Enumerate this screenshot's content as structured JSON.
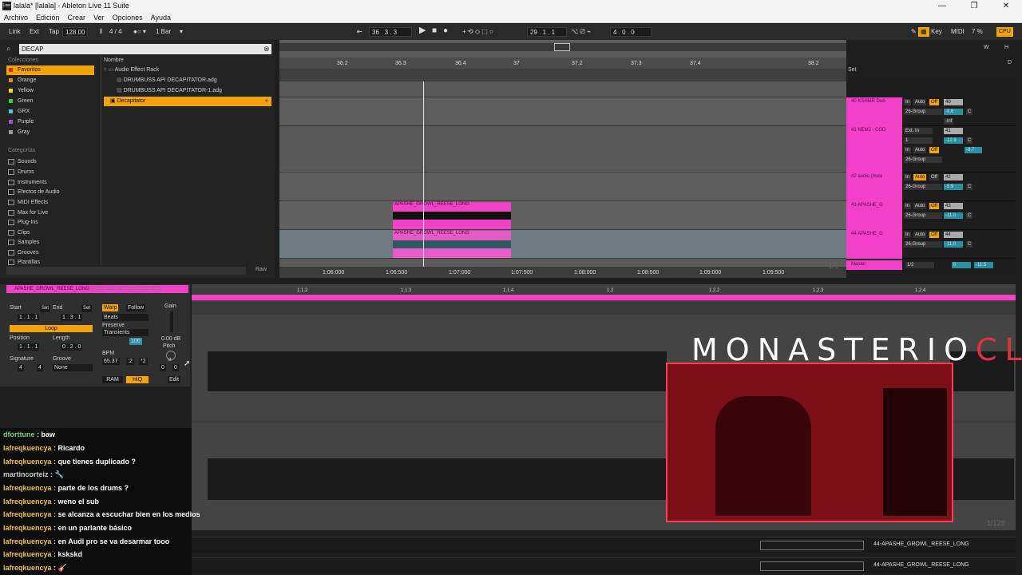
{
  "window": {
    "title": "lalala*  [lalala] - Ableton Live 11 Suite",
    "icon": "Live",
    "controls": [
      "—",
      "❐",
      "✕"
    ]
  },
  "menu": [
    "Archivo",
    "Edición",
    "Crear",
    "Ver",
    "Opciones",
    "Ayuda"
  ],
  "transport": {
    "link": "Link",
    "ext": "Ext",
    "tap": "Tap",
    "tempo": "128.00",
    "sig": "4 / 4",
    "quant": "1 Bar",
    "position": "36 .   3 .   3",
    "loop_start": "29 .   1 .   1",
    "loop_len": "4 .   0 .   0",
    "key": "Key",
    "midi": "MIDI",
    "cpu": "7 %",
    "cpu_label": "CPU",
    "h": "H",
    "w": "W",
    "d": "D"
  },
  "browser": {
    "search": "DECAP",
    "collections_header": "Colecciones",
    "collections": [
      {
        "label": "Favoritos",
        "color": "#f2a20d",
        "selected": true
      },
      {
        "label": "Orange",
        "color": "#f27f1b"
      },
      {
        "label": "Yellow",
        "color": "#f2e30d"
      },
      {
        "label": "Green",
        "color": "#3ccf3c"
      },
      {
        "label": "GRX",
        "color": "#3cc8f2"
      },
      {
        "label": "Purple",
        "color": "#a04ce0"
      },
      {
        "label": "Gray",
        "color": "#9a9a9a"
      }
    ],
    "categories_header": "Categorías",
    "categories": [
      "Sounds",
      "Drums",
      "Instruments",
      "Efectos de Audio",
      "MIDI Effects",
      "Max for Live",
      "Plug-Ins",
      "Clips",
      "Samples",
      "Grooves",
      "Plantillas"
    ],
    "name_header": "Nombre",
    "files": [
      {
        "label": "Audio Effect Rack",
        "type": "folder"
      },
      {
        "label": "DRUMBUSS API DECAPITATOR.adg",
        "type": "file"
      },
      {
        "label": "DRUMBUSS API DECAPITATOR-1.adg",
        "type": "file"
      },
      {
        "label": "Decapitator",
        "type": "plugin",
        "selected": true
      }
    ],
    "raw": "Raw"
  },
  "arrangement": {
    "ruler": [
      "36.2",
      "36.3",
      "36.4",
      "37",
      "37.2",
      "37.3",
      "37.4",
      "38.2"
    ],
    "time_ruler": [
      "1:06:000",
      "1:06:500",
      "1:07:000",
      "1:07:500",
      "1:08:000",
      "1:08:500",
      "1:09:000",
      "1:09:500"
    ],
    "set_label": "Set",
    "clips": [
      "APASHE_GROWL_REESE_LONG",
      "APASHE_GROWL_REESE_LONG"
    ],
    "page": "1/2"
  },
  "mixer": {
    "tracks": [
      {
        "name": "40 KSHMR Dub",
        "num": "40",
        "vol": "-9.6",
        "group": "26-Group",
        "pan": "C",
        "inf": "-inf"
      },
      {
        "name": "41 NEMJ - COD",
        "num": "41",
        "vol": "-12.9",
        "group": "26-Group",
        "pan": "C",
        "ext": "Ext. In",
        "ch": "1",
        "inf": "-inf",
        "send": "-8.7"
      },
      {
        "name": "42 audio (musi",
        "num": "42",
        "vol": "-5.9",
        "group": "26-Group",
        "pan": "C",
        "inf": "-inf"
      },
      {
        "name": "43 APASHE_G",
        "num": "43",
        "vol": "-11.0",
        "group": "26-Group",
        "pan": "C",
        "inf": "-inf"
      },
      {
        "name": "44 APASHE_G",
        "num": "44",
        "vol": "-11.0",
        "group": "26-Group",
        "pan": "C",
        "inf": "-inf"
      }
    ],
    "master": {
      "name": "Master",
      "ratio": "1/2",
      "vol": "0",
      "peak": "-11.5"
    },
    "labels": {
      "in": "In",
      "auto": "Auto",
      "off": "Off",
      "s": "S"
    }
  },
  "clip": {
    "title": "APASHE_GROWL_REESE_LONG",
    "info": "APAS...wav  48.0 kHz 24 Bit 2 Ch",
    "start_label": "Start",
    "end_label": "End",
    "set": "Set",
    "start": "1 .   1 .   1",
    "end": "1 .   3 .   1",
    "loop": "Loop",
    "position_label": "Position",
    "length_label": "Length",
    "position": "1 .   1 .   1",
    "length": "0 .   2 .   0",
    "signature_label": "Signature",
    "groove_label": "Groove",
    "sig_num": "4",
    "sig_den": "4",
    "groove": "None",
    "warp": "Warp",
    "follow": "Follow",
    "mode": "Beats",
    "preserve": "Preserve",
    "transients": "Transients",
    "amount": "100",
    "bpm_label": "BPM",
    "bpm": "65.37",
    "half": ":2",
    "double": "*2",
    "gain_label": "Gain",
    "gain": "0.00 dB",
    "pitch_label": "Pitch",
    "st": "st",
    "semi": "0",
    "ct": "0",
    "ram": "RAM",
    "hiq": "HiQ",
    "edit": "Edit"
  },
  "detail": {
    "ruler": [
      "1.1.2",
      "1.1.3",
      "1.1.4",
      "1.2",
      "1.2.2",
      "1.2.3",
      "1.2.4"
    ],
    "page": "1/128"
  },
  "chat": [
    {
      "user": "dforttune",
      "msg": "baw",
      "cls": "user2"
    },
    {
      "user": "lafreqkuencya",
      "msg": "Ricardo",
      "cls": "user"
    },
    {
      "user": "lafreqkuencya",
      "msg": "que tienes duplicado ?",
      "cls": "user"
    },
    {
      "user": "martincorteiz",
      "msg": "🔧",
      "cls": "user3"
    },
    {
      "user": "lafreqkuencya",
      "msg": "parte de los drums ?",
      "cls": "user"
    },
    {
      "user": "lafreqkuencya",
      "msg": "weno el sub",
      "cls": "user"
    },
    {
      "user": "lafreqkuencya",
      "msg": "se alcanza a escuchar bien en los medios",
      "cls": "user"
    },
    {
      "user": "lafreqkuencya",
      "msg": "en un parlante básico",
      "cls": "user"
    },
    {
      "user": "lafreqkuencya",
      "msg": "en Audi pro se va desarmar tooo",
      "cls": "user"
    },
    {
      "user": "lafreqkuencya",
      "msg": "kskskd",
      "cls": "user"
    },
    {
      "user": "lafreqkuencya",
      "msg": "🎸",
      "cls": "user"
    }
  ],
  "overlay": {
    "brand_a": "MONASTERIO",
    "brand_b": "CL"
  },
  "bottom": {
    "track_label": "44-APASHE_GROWL_REESE_LONG"
  }
}
